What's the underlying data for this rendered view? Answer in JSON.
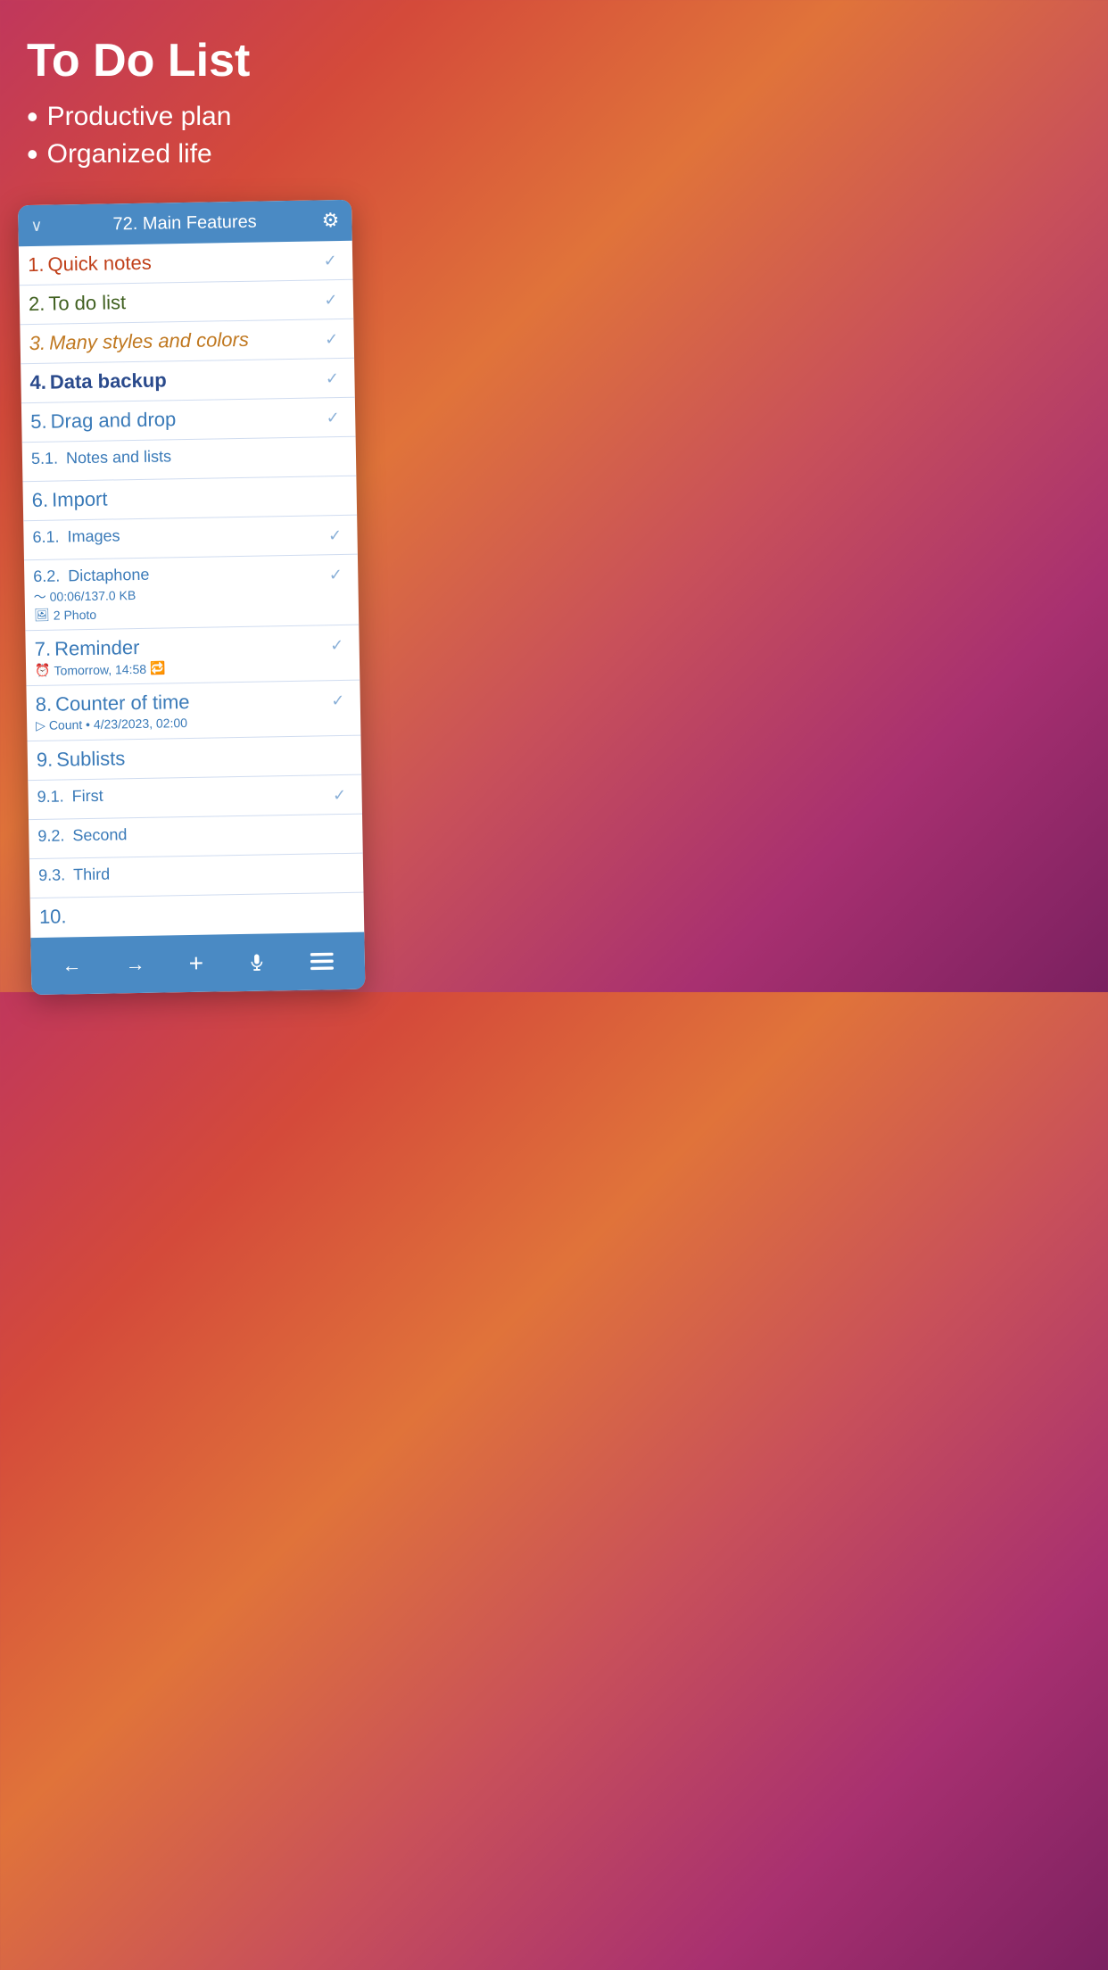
{
  "hero": {
    "title": "To Do List",
    "bullet1": "Productive plan",
    "bullet2": "Organized life"
  },
  "card": {
    "header": {
      "title": "72. Main Features",
      "chevron": "∨",
      "gear": "⚙"
    },
    "items": [
      {
        "id": "1",
        "num": "1.",
        "text": "Quick notes",
        "checked": true,
        "style": "item-1"
      },
      {
        "id": "2",
        "num": "2.",
        "text": "To do list",
        "checked": true,
        "style": "item-2"
      },
      {
        "id": "3",
        "num": "3.",
        "text": "Many styles and colors",
        "checked": true,
        "style": "item-3"
      },
      {
        "id": "4",
        "num": "4.",
        "text": "Data backup",
        "checked": true,
        "style": "item-4"
      },
      {
        "id": "5",
        "num": "5.",
        "text": "Drag and drop",
        "checked": false,
        "style": "item-5"
      },
      {
        "id": "5-1",
        "num": "5.1.",
        "text": "Notes and lists",
        "checked": false,
        "style": "item-5-1 sub-item"
      },
      {
        "id": "6",
        "num": "6.",
        "text": "Import",
        "checked": false,
        "style": "item-6"
      },
      {
        "id": "6-1",
        "num": "6.1.",
        "text": "Images",
        "checked": false,
        "style": "item-6-1 sub-item"
      },
      {
        "id": "6-2",
        "num": "6.2.",
        "text": "Dictaphone",
        "checked": true,
        "style": "item-6-2 sub-item",
        "subinfo1": "00:06/137.0 KB",
        "subinfo2": "2 Photo"
      },
      {
        "id": "7",
        "num": "7.",
        "text": "Reminder",
        "checked": true,
        "style": "item-7",
        "reminder": "Tomorrow, 14:58"
      },
      {
        "id": "8",
        "num": "8.",
        "text": "Counter of time",
        "checked": true,
        "style": "item-8",
        "counter": "Count • 4/23/2023, 02:00"
      },
      {
        "id": "9",
        "num": "9.",
        "text": "Sublists",
        "checked": false,
        "style": "item-9"
      },
      {
        "id": "9-1",
        "num": "9.1.",
        "text": "First",
        "checked": true,
        "style": "sub-item"
      },
      {
        "id": "9-2",
        "num": "9.2.",
        "text": "Second",
        "checked": false,
        "style": "sub-item"
      },
      {
        "id": "9-3",
        "num": "9.3.",
        "text": "Third",
        "checked": false,
        "style": "sub-item"
      },
      {
        "id": "10",
        "num": "10.",
        "text": "",
        "checked": false,
        "style": "item-10"
      }
    ],
    "toolbar": {
      "back": "←",
      "forward": "→",
      "add": "+",
      "mic": "🎤",
      "menu": "≡"
    }
  }
}
